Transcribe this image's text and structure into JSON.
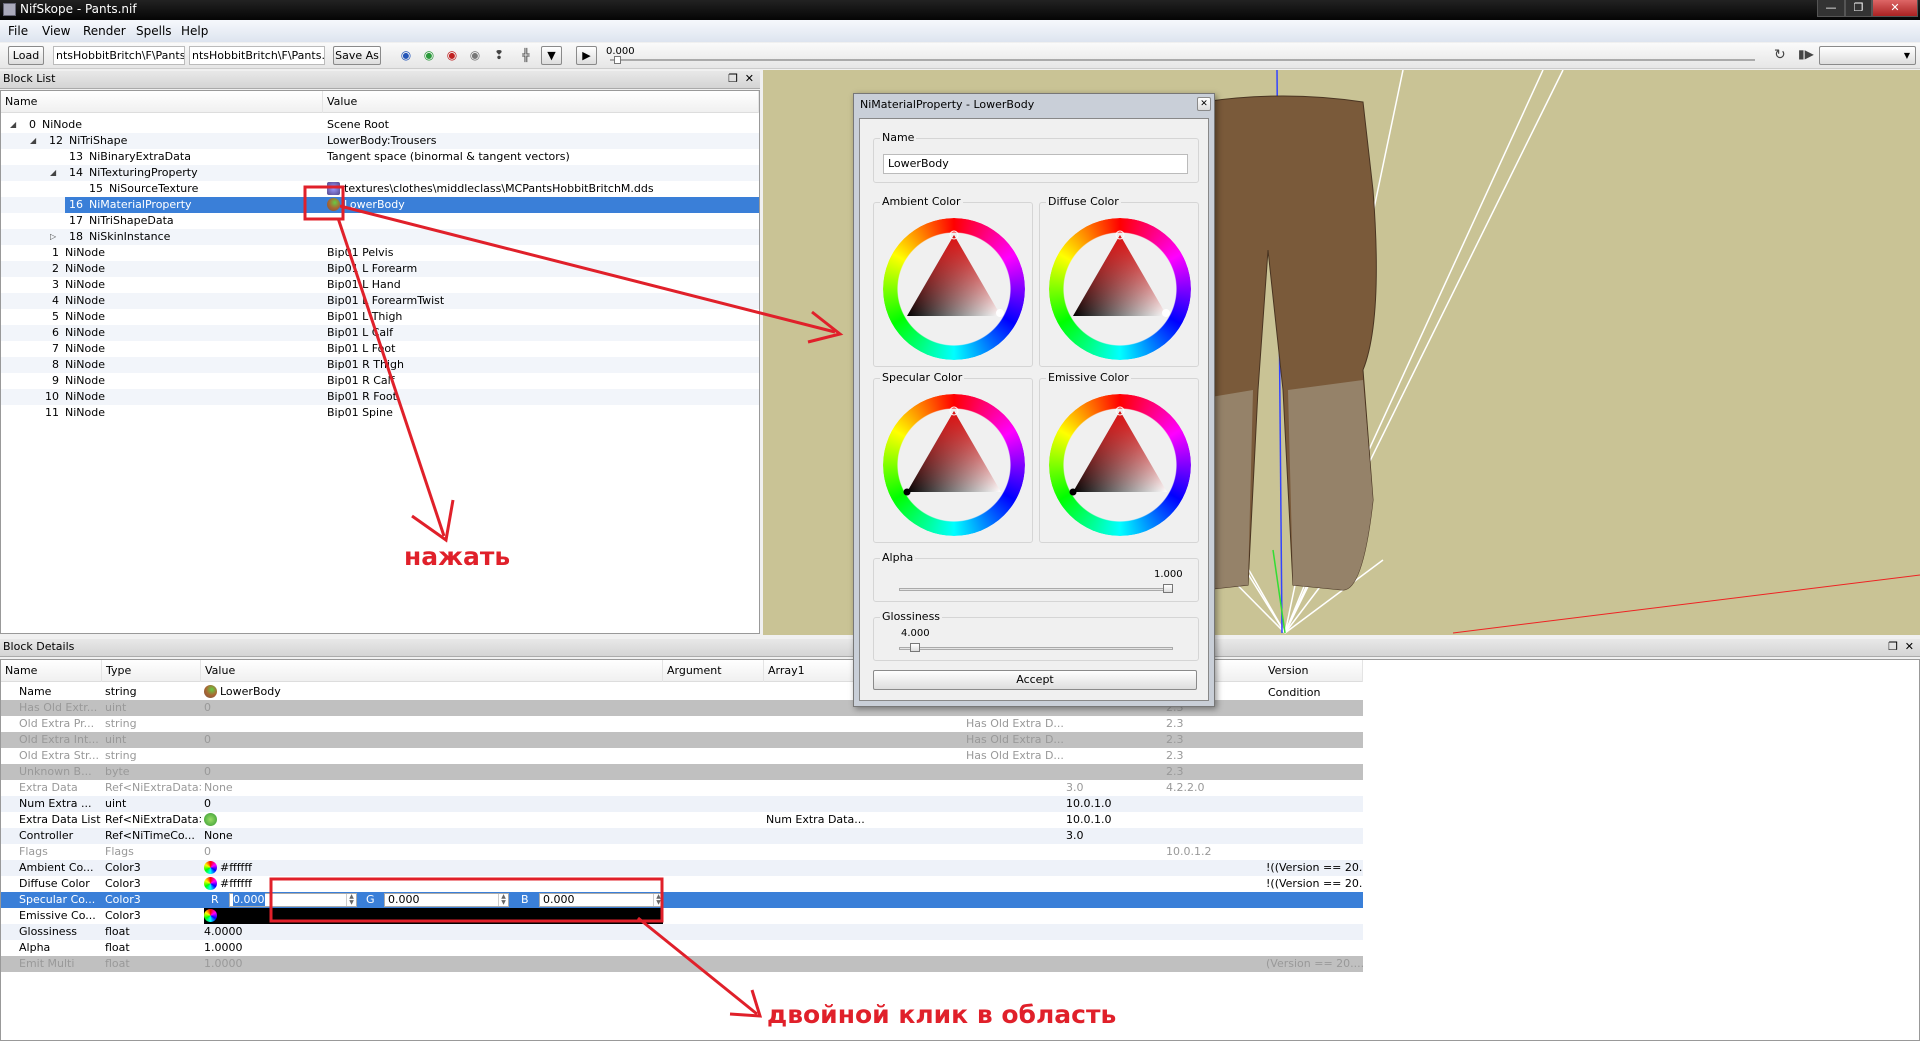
{
  "window": {
    "title": "NifSkope - Pants.nif"
  },
  "menu": [
    "File",
    "View",
    "Render",
    "Spells",
    "Help"
  ],
  "toolbar": {
    "load": "Load",
    "path1": "ntsHobbitBritch\\F\\Pants.nif",
    "path2": "ntsHobbitBritch\\F\\Pants.nif",
    "save_as": "Save As",
    "time": "0.000"
  },
  "block_list": {
    "title": "Block List",
    "columns": [
      "Name",
      "Value"
    ],
    "rows": [
      {
        "level": 0,
        "exp": "open",
        "num": "0",
        "name": "NiNode",
        "value": "Scene Root"
      },
      {
        "level": 1,
        "exp": "open",
        "num": "12",
        "name": "NiTriShape",
        "value": "LowerBody:Trousers"
      },
      {
        "level": 2,
        "exp": "",
        "num": "13",
        "name": "NiBinaryExtraData",
        "value": "Tangent space (binormal & tangent vectors)"
      },
      {
        "level": 2,
        "exp": "open",
        "num": "14",
        "name": "NiTexturingProperty",
        "value": ""
      },
      {
        "level": 3,
        "exp": "",
        "num": "15",
        "name": "NiSourceTexture",
        "value": "textures\\clothes\\middleclass\\MCPantsHobbitBritchM.dds",
        "icon": "texture"
      },
      {
        "level": 2,
        "exp": "",
        "num": "16",
        "name": "NiMaterialProperty",
        "value": "LowerBody",
        "icon": "material",
        "selected": true
      },
      {
        "level": 2,
        "exp": "",
        "num": "17",
        "name": "NiTriShapeData",
        "value": ""
      },
      {
        "level": 2,
        "exp": "closed",
        "num": "18",
        "name": "NiSkinInstance",
        "value": ""
      },
      {
        "level": -1,
        "exp": "",
        "num": "1",
        "name": "NiNode",
        "value": "Bip01 Pelvis"
      },
      {
        "level": -1,
        "exp": "",
        "num": "2",
        "name": "NiNode",
        "value": "Bip01 L Forearm"
      },
      {
        "level": -1,
        "exp": "",
        "num": "3",
        "name": "NiNode",
        "value": "Bip01 L Hand"
      },
      {
        "level": -1,
        "exp": "",
        "num": "4",
        "name": "NiNode",
        "value": "Bip01 L ForearmTwist"
      },
      {
        "level": -1,
        "exp": "",
        "num": "5",
        "name": "NiNode",
        "value": "Bip01 L Thigh"
      },
      {
        "level": -1,
        "exp": "",
        "num": "6",
        "name": "NiNode",
        "value": "Bip01 L Calf"
      },
      {
        "level": -1,
        "exp": "",
        "num": "7",
        "name": "NiNode",
        "value": "Bip01 L Foot"
      },
      {
        "level": -1,
        "exp": "",
        "num": "8",
        "name": "NiNode",
        "value": "Bip01 R Thigh"
      },
      {
        "level": -1,
        "exp": "",
        "num": "9",
        "name": "NiNode",
        "value": "Bip01 R Calf"
      },
      {
        "level": -1,
        "exp": "",
        "num": "10",
        "name": "NiNode",
        "value": "Bip01 R Foot"
      },
      {
        "level": -1,
        "exp": "",
        "num": "11",
        "name": "NiNode",
        "value": "Bip01 Spine"
      }
    ]
  },
  "block_details": {
    "title": "Block Details",
    "columns": [
      "Name",
      "Type",
      "Value",
      "Argument",
      "Array1",
      "Version Condition"
    ],
    "rows": [
      {
        "name": "Name",
        "type": "string",
        "value": "LowerBody",
        "icon": "material",
        "style": ""
      },
      {
        "name": "Has Old Extr...",
        "type": "uint",
        "value": "0",
        "until": "2.3",
        "style": "gray"
      },
      {
        "name": "Old Extra Pr...",
        "type": "string",
        "value": "",
        "cond": "Has Old Extra D...",
        "until": "2.3",
        "style": "dis"
      },
      {
        "name": "Old Extra Int...",
        "type": "uint",
        "value": "0",
        "cond": "Has Old Extra D...",
        "until": "2.3",
        "style": "gray"
      },
      {
        "name": "Old Extra Str...",
        "type": "string",
        "value": "",
        "cond": "Has Old Extra D...",
        "until": "2.3",
        "style": "dis"
      },
      {
        "name": "Unknown B...",
        "type": "byte",
        "value": "0",
        "until": "2.3",
        "style": "gray"
      },
      {
        "name": "Extra Data",
        "type": "Ref<NiExtraData>",
        "value": "None",
        "since": "3.0",
        "until": "4.2.2.0",
        "style": "dis"
      },
      {
        "name": "Num Extra ...",
        "type": "uint",
        "value": "0",
        "since": "10.0.1.0",
        "style": "alt"
      },
      {
        "name": "Extra Data List",
        "type": "Ref<NiExtraData>",
        "value": "",
        "icon": "refresh",
        "array1": "Num Extra Data...",
        "since": "10.0.1.0",
        "style": ""
      },
      {
        "name": "Controller",
        "type": "Ref<NiTimeCo...",
        "value": "None",
        "since": "3.0",
        "style": "alt"
      },
      {
        "name": "Flags",
        "type": "Flags",
        "value": "0",
        "until": "10.0.1.2",
        "style": "dis"
      },
      {
        "name": "Ambient Co...",
        "type": "Color3",
        "value": "#ffffff",
        "icon": "color",
        "vcond": "!((Version == 20...",
        "style": "alt"
      },
      {
        "name": "Diffuse Color",
        "type": "Color3",
        "value": "#ffffff",
        "icon": "color",
        "vcond": "!((Version == 20...",
        "style": ""
      },
      {
        "name": "Specular Co...",
        "type": "Color3",
        "value": "",
        "style": "sel",
        "editor": true
      },
      {
        "name": "Emissive Co...",
        "type": "Color3",
        "value": "",
        "icon": "color",
        "style": "",
        "black": true
      },
      {
        "name": "Glossiness",
        "type": "float",
        "value": "4.0000",
        "style": "alt"
      },
      {
        "name": "Alpha",
        "type": "float",
        "value": "1.0000",
        "style": ""
      },
      {
        "name": "Emit Multi",
        "type": "float",
        "value": "1.0000",
        "vcond": "(Version == 20....",
        "style": "gray"
      }
    ],
    "color_editor": {
      "r_label": "R",
      "g_label": "G",
      "b_label": "B",
      "r": "0.000",
      "g": "0.000",
      "b": "0.000"
    }
  },
  "dialog": {
    "title": "NiMaterialProperty - LowerBody",
    "name_label": "Name",
    "name_value": "LowerBody",
    "ambient": "Ambient Color",
    "diffuse": "Diffuse Color",
    "specular": "Specular Color",
    "emissive": "Emissive Color",
    "alpha_label": "Alpha",
    "alpha_value": "1.000",
    "alpha_fraction": 1.0,
    "gloss_label": "Glossiness",
    "gloss_value": "4.000",
    "gloss_fraction": 0.04,
    "accept": "Accept"
  },
  "annotations": {
    "click": "нажать",
    "double_click": "двойной клик в область",
    "color": "#e0202a"
  },
  "colors": {
    "selection": "#3a7fd8",
    "viewport": "#c9c395"
  }
}
